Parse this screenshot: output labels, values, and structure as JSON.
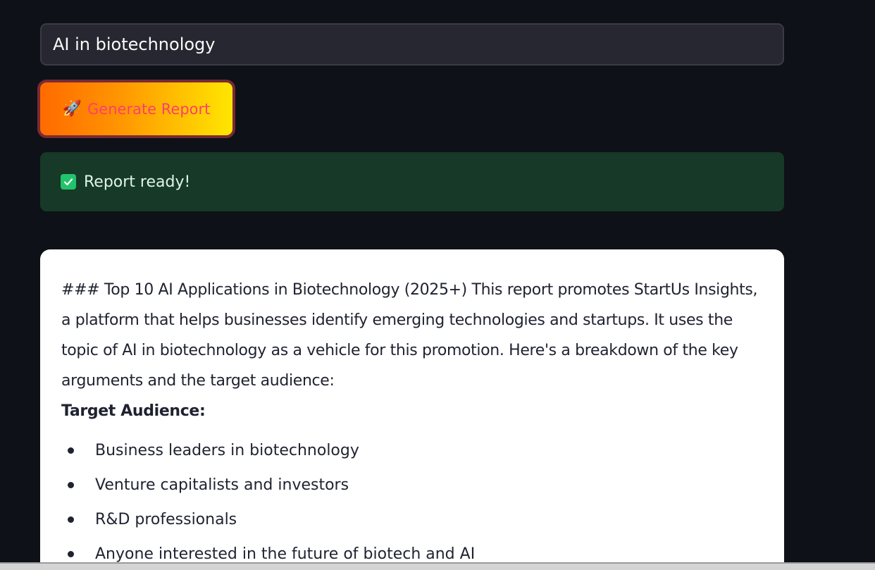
{
  "search": {
    "value": "AI in biotechnology",
    "placeholder": ""
  },
  "generate_button": {
    "icon": "rocket-icon",
    "label": "Generate Report"
  },
  "status": {
    "icon": "check-icon",
    "message": "Report ready!"
  },
  "report": {
    "intro": "### Top 10 AI Applications in Biotechnology (2025+) This report promotes StartUs Insights, a platform that helps businesses identify emerging technologies and startups. It uses the topic of AI in biotechnology as a vehicle for this promotion. Here's a breakdown of the key arguments and the target audience:",
    "audience_heading": "Target Audience:",
    "audience_items": [
      "Business leaders in biotechnology",
      "Venture capitalists and investors",
      "R&D professionals",
      "Anyone interested in the future of biotech and AI"
    ]
  },
  "colors": {
    "background": "#0e1117",
    "input_bg": "#262730",
    "success_bg": "#173928",
    "success_icon": "#21c36b",
    "button_gradient_start": "#ff6a00",
    "button_gradient_end": "#ffe600",
    "button_text": "#ff3d6e"
  }
}
